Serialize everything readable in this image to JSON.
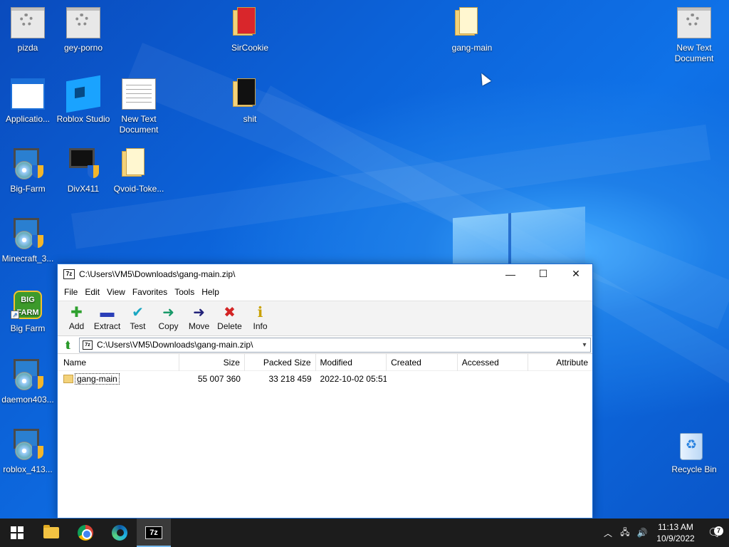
{
  "desktop": {
    "icons": [
      {
        "label": "pizda"
      },
      {
        "label": "gey-porno"
      },
      {
        "label": "SirCookie"
      },
      {
        "label": "gang-main"
      },
      {
        "label": "New Text Document"
      },
      {
        "label": "Applicatio..."
      },
      {
        "label": "Roblox Studio"
      },
      {
        "label": "New Text Document"
      },
      {
        "label": "shit"
      },
      {
        "label": "Big-Farm"
      },
      {
        "label": "DivX411"
      },
      {
        "label": "Qvoid-Toke..."
      },
      {
        "label": "Minecraft_3..."
      },
      {
        "label": "Big Farm"
      },
      {
        "label": "daemon403..."
      },
      {
        "label": "roblox_413..."
      },
      {
        "label": "Recycle Bin"
      }
    ]
  },
  "window": {
    "app_icon": "7z",
    "title": "C:\\Users\\VM5\\Downloads\\gang-main.zip\\",
    "menu": [
      "File",
      "Edit",
      "View",
      "Favorites",
      "Tools",
      "Help"
    ],
    "toolbar": [
      {
        "label": "Add",
        "icon": "plus-icon",
        "color": "#2ea02e",
        "glyph": "✚"
      },
      {
        "label": "Extract",
        "icon": "minus-icon",
        "color": "#2b3fb8",
        "glyph": "▬"
      },
      {
        "label": "Test",
        "icon": "check-icon",
        "color": "#1aa7c2",
        "glyph": "✔"
      },
      {
        "label": "Copy",
        "icon": "arrow-right-icon",
        "color": "#1a9a6a",
        "glyph": "➜"
      },
      {
        "label": "Move",
        "icon": "arrow-right-icon",
        "color": "#23237a",
        "glyph": "➜"
      },
      {
        "label": "Delete",
        "icon": "x-icon",
        "color": "#d32424",
        "glyph": "✖"
      },
      {
        "label": "Info",
        "icon": "info-icon",
        "color": "#c9a100",
        "glyph": "ℹ"
      }
    ],
    "address": {
      "path": "C:\\Users\\VM5\\Downloads\\gang-main.zip\\"
    },
    "columns": [
      "Name",
      "Size",
      "Packed Size",
      "Modified",
      "Created",
      "Accessed",
      "Attribute"
    ],
    "rows": [
      {
        "name": "gang-main",
        "size": "55 007 360",
        "packed": "33 218 459",
        "modified": "2022-10-02 05:51",
        "created": "",
        "accessed": "",
        "attr": ""
      }
    ]
  },
  "taskbar": {
    "apps": [
      "start",
      "file-explorer",
      "chrome",
      "edge",
      "7-zip"
    ],
    "z7_label": "7z",
    "clock": {
      "time": "11:13 AM",
      "date": "10/9/2022"
    },
    "notifications": "7"
  }
}
